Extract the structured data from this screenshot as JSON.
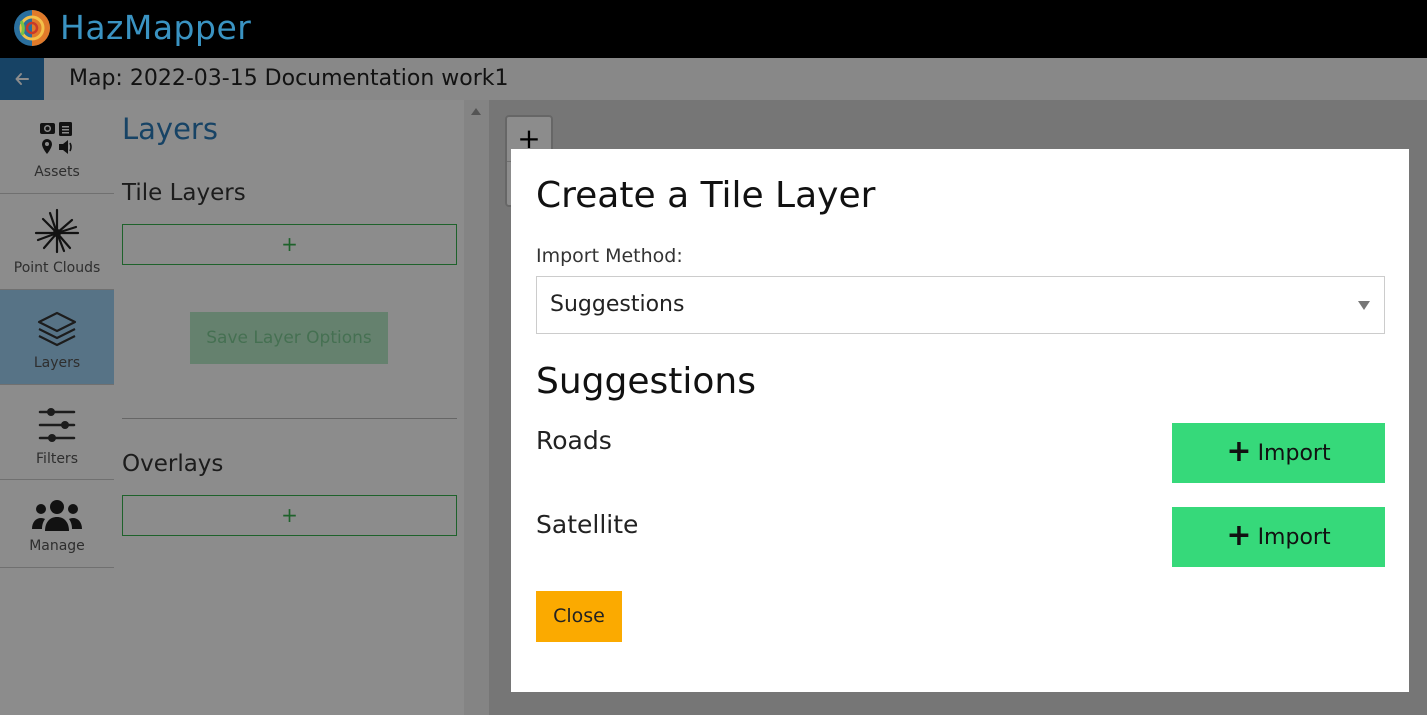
{
  "app": {
    "title": "HazMapper",
    "map_title": "Map: 2022-03-15 Documentation work1"
  },
  "nav": {
    "items": [
      {
        "label": "Assets",
        "icon": "assets-icon"
      },
      {
        "label": "Point Clouds",
        "icon": "point-cloud-icon"
      },
      {
        "label": "Layers",
        "icon": "layers-icon",
        "active": true
      },
      {
        "label": "Filters",
        "icon": "filters-icon"
      },
      {
        "label": "Manage",
        "icon": "users-icon"
      }
    ]
  },
  "panel": {
    "title": "Layers",
    "tile_layers_title": "Tile Layers",
    "add_symbol": "+",
    "save_label": "Save Layer Options",
    "overlays_title": "Overlays"
  },
  "map": {
    "zoom_in": "+"
  },
  "modal": {
    "title": "Create a Tile Layer",
    "import_method_label": "Import Method:",
    "import_method_value": "Suggestions",
    "suggestions_title": "Suggestions",
    "suggestions": [
      {
        "name": "Roads",
        "button": "Import"
      },
      {
        "name": "Satellite",
        "button": "Import"
      }
    ],
    "close_label": "Close"
  },
  "colors": {
    "brand": "#3a93c2",
    "accent_blue": "#2b7bb9",
    "success_green": "#36d97a",
    "warning_orange": "#fbaa00"
  }
}
